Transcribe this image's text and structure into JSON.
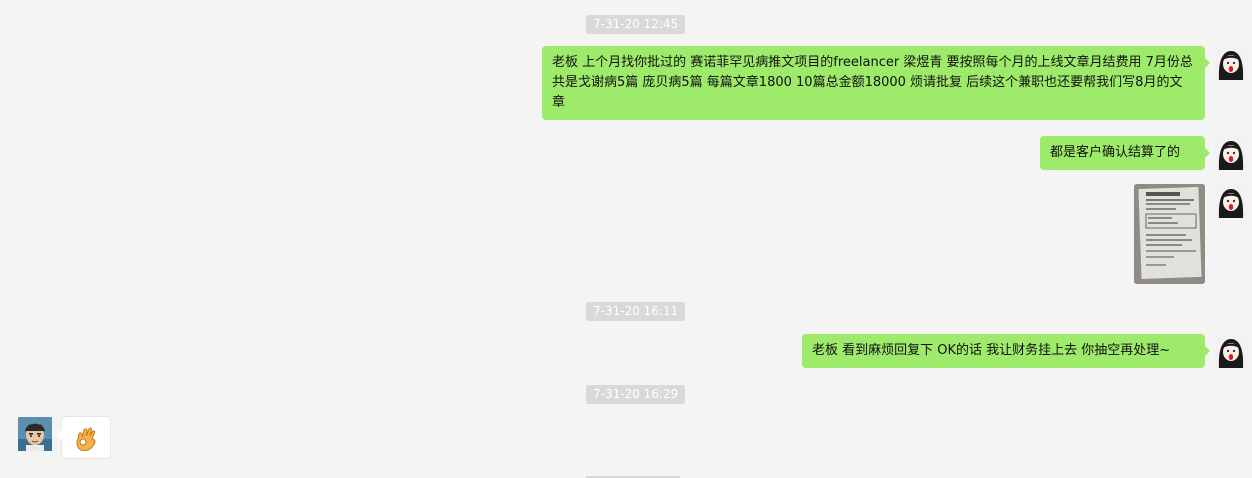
{
  "timestamps": [
    "7-31-20 12:45",
    "7-31-20 16:11",
    "7-31-20 16:29"
  ],
  "messages": {
    "m1": "老板 上个月找你批过的 赛诺菲罕见病推文项目的freelancer 梁煜青 要按照每个月的上线文章月结费用 7月份总共是戈谢病5篇 庞贝病5篇 每篇文章1800 10篇总金额18000 烦请批复 后续这个兼职也还要帮我们写8月的文章",
    "m2": "都是客户确认结算了的",
    "m4": "老板 看到麻烦回复下 OK的话 我让财务挂上去 你抽空再处理~",
    "m5_sticker": "ok-hand-emoji"
  },
  "colors": {
    "background": "#f4f4f4",
    "outgoing_bubble": "#9eea6a",
    "incoming_bubble": "#ffffff",
    "timestamp_bg": "#d9d9d9"
  },
  "icons": {
    "self_avatar": "cartoon-girl-avatar",
    "other_avatar": "cartoon-boy-avatar",
    "image_message": "document-photo"
  }
}
